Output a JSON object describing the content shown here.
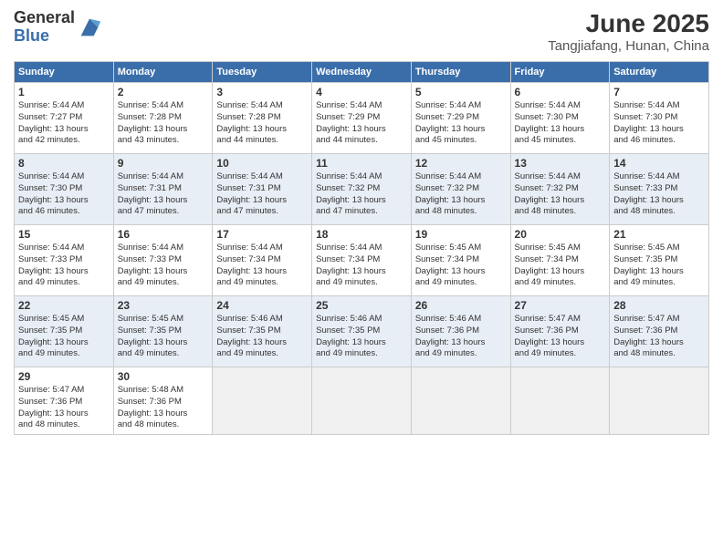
{
  "logo": {
    "general": "General",
    "blue": "Blue"
  },
  "title": "June 2025",
  "subtitle": "Tangjiafang, Hunan, China",
  "days": [
    "Sunday",
    "Monday",
    "Tuesday",
    "Wednesday",
    "Thursday",
    "Friday",
    "Saturday"
  ],
  "weeks": [
    [
      {
        "day": 1,
        "sunrise": "5:44 AM",
        "sunset": "7:27 PM",
        "hours": "13",
        "mins": "42"
      },
      {
        "day": 2,
        "sunrise": "5:44 AM",
        "sunset": "7:28 PM",
        "hours": "13",
        "mins": "43"
      },
      {
        "day": 3,
        "sunrise": "5:44 AM",
        "sunset": "7:28 PM",
        "hours": "13",
        "mins": "44"
      },
      {
        "day": 4,
        "sunrise": "5:44 AM",
        "sunset": "7:29 PM",
        "hours": "13",
        "mins": "44"
      },
      {
        "day": 5,
        "sunrise": "5:44 AM",
        "sunset": "7:29 PM",
        "hours": "13",
        "mins": "45"
      },
      {
        "day": 6,
        "sunrise": "5:44 AM",
        "sunset": "7:30 PM",
        "hours": "13",
        "mins": "45"
      },
      {
        "day": 7,
        "sunrise": "5:44 AM",
        "sunset": "7:30 PM",
        "hours": "13",
        "mins": "46"
      }
    ],
    [
      {
        "day": 8,
        "sunrise": "5:44 AM",
        "sunset": "7:30 PM",
        "hours": "13",
        "mins": "46"
      },
      {
        "day": 9,
        "sunrise": "5:44 AM",
        "sunset": "7:31 PM",
        "hours": "13",
        "mins": "47"
      },
      {
        "day": 10,
        "sunrise": "5:44 AM",
        "sunset": "7:31 PM",
        "hours": "13",
        "mins": "47"
      },
      {
        "day": 11,
        "sunrise": "5:44 AM",
        "sunset": "7:32 PM",
        "hours": "13",
        "mins": "47"
      },
      {
        "day": 12,
        "sunrise": "5:44 AM",
        "sunset": "7:32 PM",
        "hours": "13",
        "mins": "48"
      },
      {
        "day": 13,
        "sunrise": "5:44 AM",
        "sunset": "7:32 PM",
        "hours": "13",
        "mins": "48"
      },
      {
        "day": 14,
        "sunrise": "5:44 AM",
        "sunset": "7:33 PM",
        "hours": "13",
        "mins": "48"
      }
    ],
    [
      {
        "day": 15,
        "sunrise": "5:44 AM",
        "sunset": "7:33 PM",
        "hours": "13",
        "mins": "49"
      },
      {
        "day": 16,
        "sunrise": "5:44 AM",
        "sunset": "7:33 PM",
        "hours": "13",
        "mins": "49"
      },
      {
        "day": 17,
        "sunrise": "5:44 AM",
        "sunset": "7:34 PM",
        "hours": "13",
        "mins": "49"
      },
      {
        "day": 18,
        "sunrise": "5:44 AM",
        "sunset": "7:34 PM",
        "hours": "13",
        "mins": "49"
      },
      {
        "day": 19,
        "sunrise": "5:45 AM",
        "sunset": "7:34 PM",
        "hours": "13",
        "mins": "49"
      },
      {
        "day": 20,
        "sunrise": "5:45 AM",
        "sunset": "7:34 PM",
        "hours": "13",
        "mins": "49"
      },
      {
        "day": 21,
        "sunrise": "5:45 AM",
        "sunset": "7:35 PM",
        "hours": "13",
        "mins": "49"
      }
    ],
    [
      {
        "day": 22,
        "sunrise": "5:45 AM",
        "sunset": "7:35 PM",
        "hours": "13",
        "mins": "49"
      },
      {
        "day": 23,
        "sunrise": "5:45 AM",
        "sunset": "7:35 PM",
        "hours": "13",
        "mins": "49"
      },
      {
        "day": 24,
        "sunrise": "5:46 AM",
        "sunset": "7:35 PM",
        "hours": "13",
        "mins": "49"
      },
      {
        "day": 25,
        "sunrise": "5:46 AM",
        "sunset": "7:35 PM",
        "hours": "13",
        "mins": "49"
      },
      {
        "day": 26,
        "sunrise": "5:46 AM",
        "sunset": "7:36 PM",
        "hours": "13",
        "mins": "49"
      },
      {
        "day": 27,
        "sunrise": "5:47 AM",
        "sunset": "7:36 PM",
        "hours": "13",
        "mins": "49"
      },
      {
        "day": 28,
        "sunrise": "5:47 AM",
        "sunset": "7:36 PM",
        "hours": "13",
        "mins": "48"
      }
    ],
    [
      {
        "day": 29,
        "sunrise": "5:47 AM",
        "sunset": "7:36 PM",
        "hours": "13",
        "mins": "48"
      },
      {
        "day": 30,
        "sunrise": "5:48 AM",
        "sunset": "7:36 PM",
        "hours": "13",
        "mins": "48"
      },
      null,
      null,
      null,
      null,
      null
    ]
  ]
}
